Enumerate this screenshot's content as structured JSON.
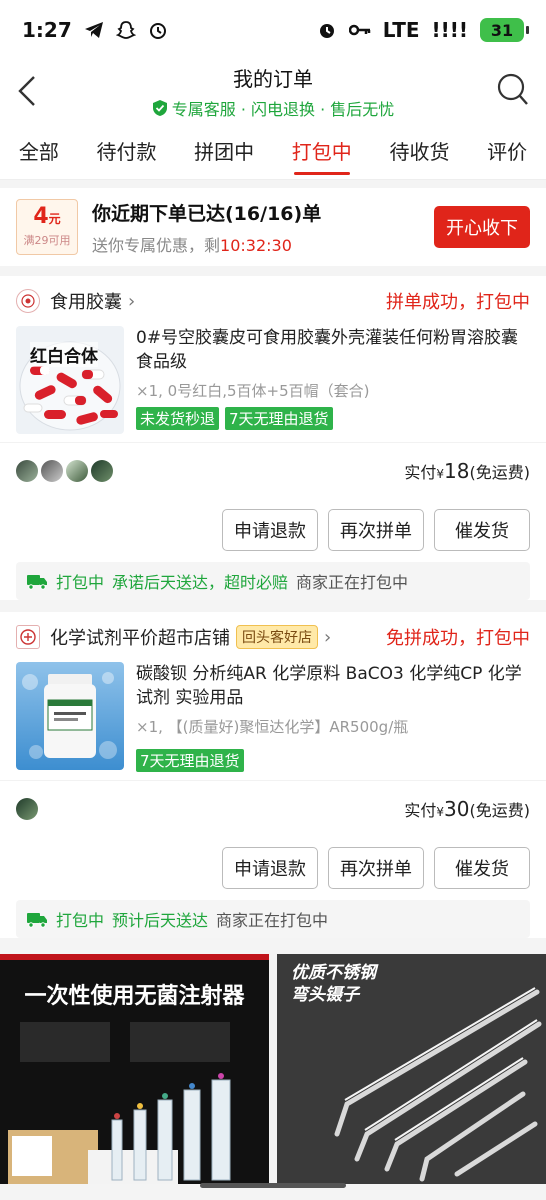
{
  "status_bar": {
    "time": "1:27",
    "network": "LTE",
    "signal": "!!!!",
    "battery": "31"
  },
  "header": {
    "title": "我的订单",
    "subtitle": "专属客服 · 闪电退换 · 售后无忧"
  },
  "tabs": [
    {
      "label": "全部"
    },
    {
      "label": "待付款"
    },
    {
      "label": "拼团中"
    },
    {
      "label": "打包中"
    },
    {
      "label": "待收货"
    },
    {
      "label": "评价"
    }
  ],
  "active_tab": "打包中",
  "promo": {
    "coupon_amount": "4",
    "coupon_unit": "元",
    "coupon_condition": "满29可用",
    "title": "你近期下单已达(16/16)单",
    "sub_prefix": "送你专属优惠，剩",
    "timer": "10:32:30",
    "button": "开心收下"
  },
  "orders": [
    {
      "shop_name": "食用胶囊",
      "shop_badge": "",
      "status": "拼单成功，打包中",
      "thumb_label": "红白合体",
      "title": "0#号空胶囊皮可食用胶囊外壳灌装任何粉胃溶胶囊食品级",
      "spec": "×1,  0号红白,5百体+5百帽（套合)",
      "tags": [
        "未发货秒退",
        "7天无理由退货"
      ],
      "price_label": "实付",
      "currency": "¥",
      "price": "18",
      "shipping": "(免运费)",
      "actions": [
        "申请退款",
        "再次拼单",
        "催发货"
      ],
      "notice_status": "打包中",
      "notice_text": "承诺后天送达，超时必赔",
      "notice_extra": "商家正在打包中"
    },
    {
      "shop_name": "化学试剂平价超市店铺",
      "shop_badge": "回头客好店",
      "status": "免拼成功，打包中",
      "thumb_label": "",
      "title": "碳酸钡 分析纯AR 化学原料 BaCO3 化学纯CP 化学试剂 实验用品",
      "spec": "×1,  【(质量好)聚恒达化学】AR500g/瓶",
      "tags": [
        "7天无理由退货"
      ],
      "price_label": "实付",
      "currency": "¥",
      "price": "30",
      "shipping": "(免运费)",
      "actions": [
        "申请退款",
        "再次拼单",
        "催发货"
      ],
      "notice_status": "打包中",
      "notice_text": "预计后天送达",
      "notice_extra": "商家正在打包中"
    }
  ],
  "banners": {
    "left": "一次性使用无菌注射器",
    "right_line1": "优质不锈钢",
    "right_line2": "弯头镊子"
  },
  "colors": {
    "accent": "#e0251a",
    "green": "#1fa63c",
    "tag_green": "#2fb34a"
  }
}
